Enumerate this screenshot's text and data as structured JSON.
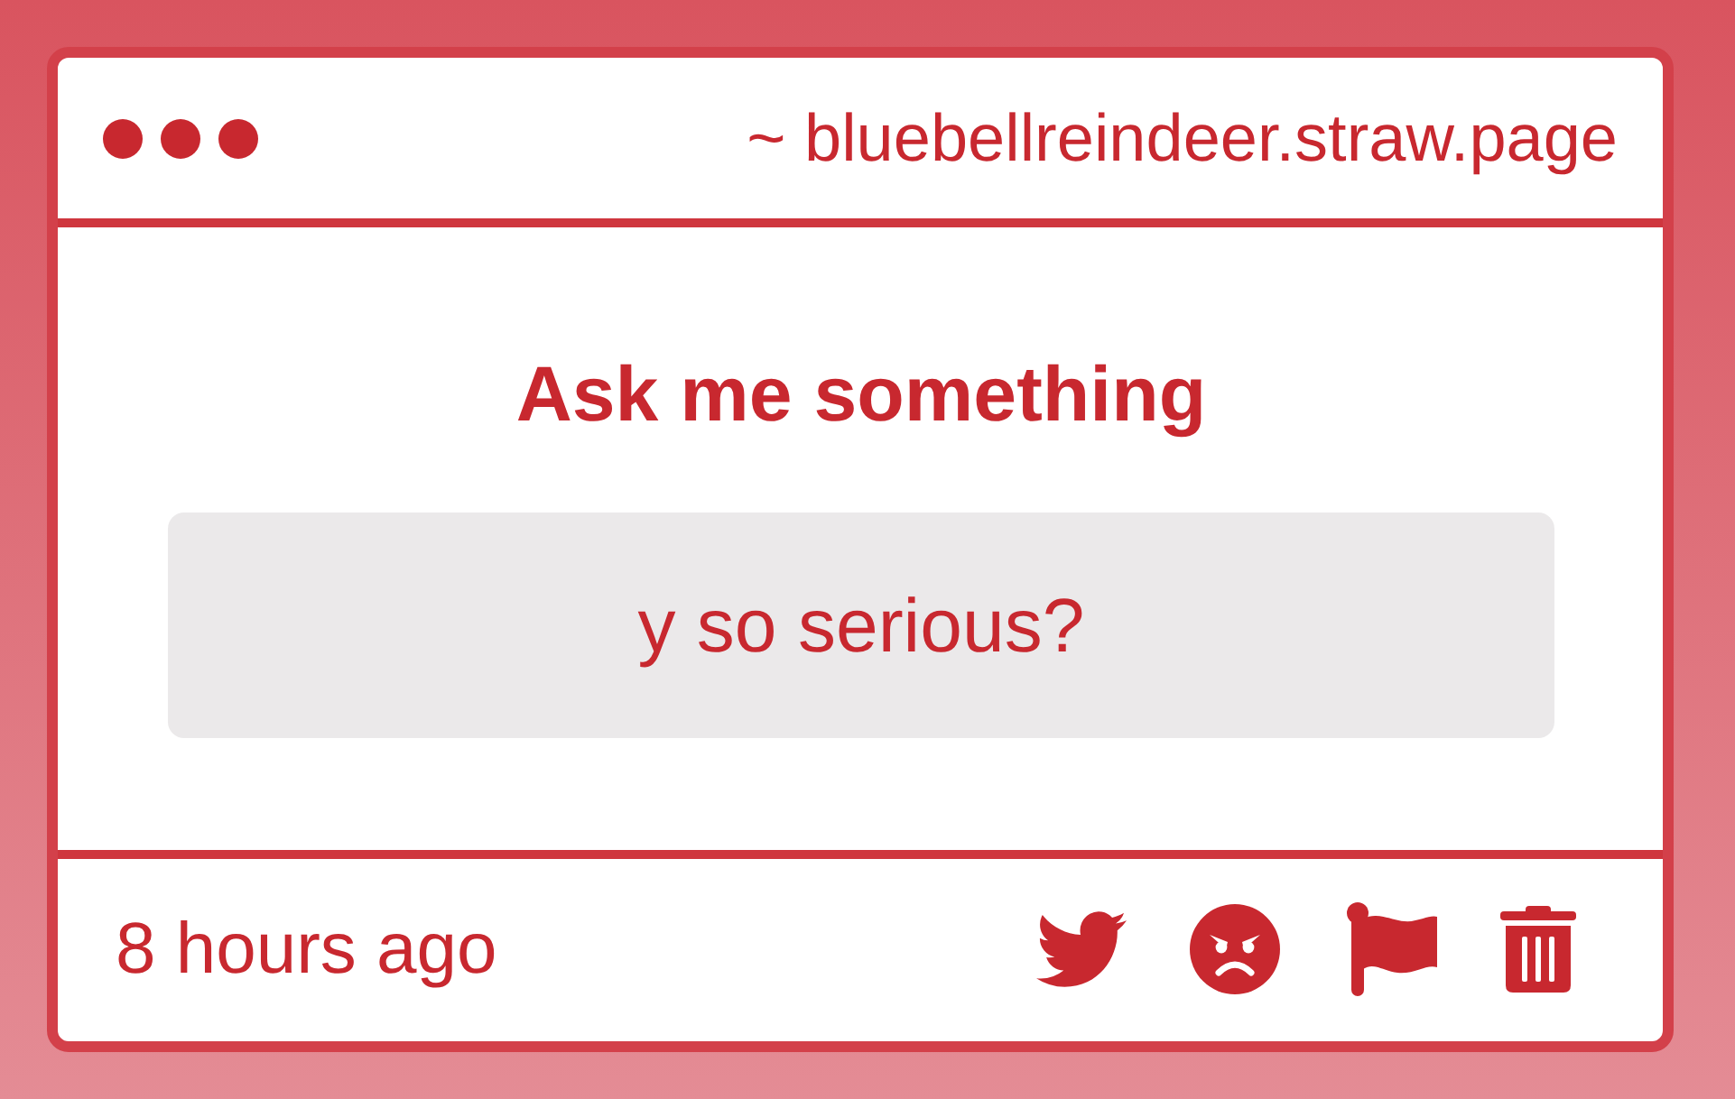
{
  "window": {
    "title": "~ bluebellreindeer.straw.page"
  },
  "heading": "Ask me something",
  "question": {
    "text": "y so serious?"
  },
  "footer": {
    "time": "8 hours ago"
  }
}
